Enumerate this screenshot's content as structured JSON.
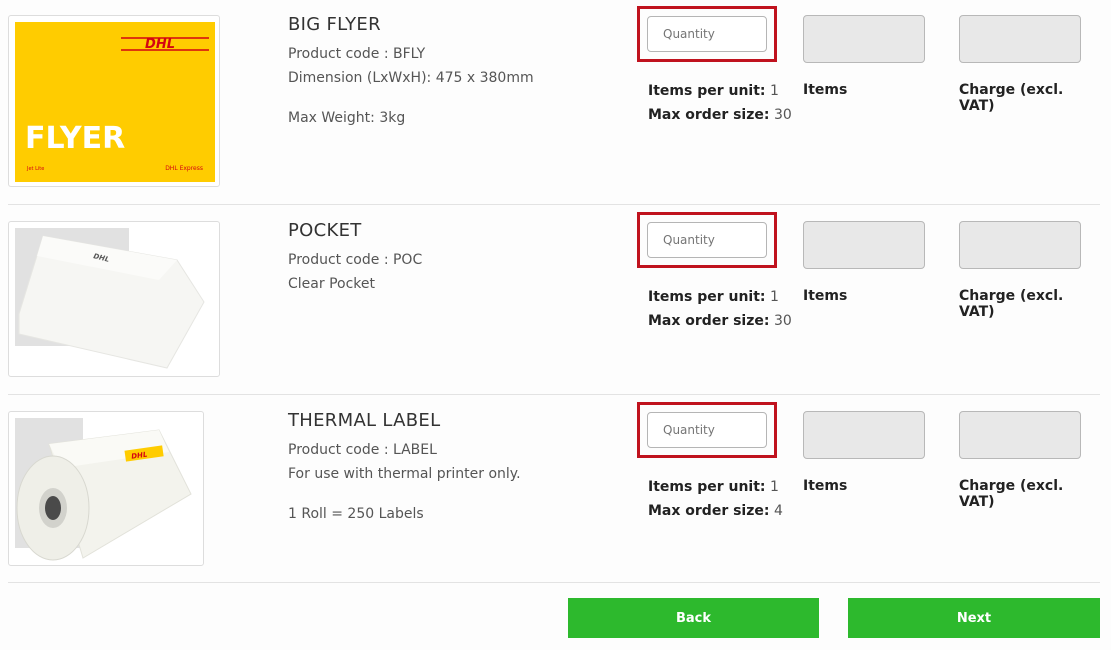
{
  "products": [
    {
      "title": "BIG FLYER",
      "code_line": "Product code : BFLY",
      "line2": "Dimension (LxWxH): 475 x 380mm",
      "line3": "Max Weight: 3kg",
      "qty_placeholder": "Quantity",
      "items_per_unit_label": "Items per unit:",
      "items_per_unit_value": "1",
      "max_order_label": "Max order size:",
      "max_order_value": "30",
      "items_label": "Items",
      "charge_label": "Charge (excl. VAT)",
      "image": {
        "brand": "DHL",
        "word": "FLYER",
        "small_left": "Jet Lite",
        "small_right": "DHL Express"
      }
    },
    {
      "title": "POCKET",
      "code_line": "Product code : POC",
      "line2": "Clear Pocket",
      "qty_placeholder": "Quantity",
      "items_per_unit_label": "Items per unit:",
      "items_per_unit_value": "1",
      "max_order_label": "Max order size:",
      "max_order_value": "30",
      "items_label": "Items",
      "charge_label": "Charge (excl. VAT)",
      "image": {
        "brand": "DHL"
      }
    },
    {
      "title": "THERMAL LABEL",
      "code_line": "Product code : LABEL",
      "line2": "For use with thermal printer only.",
      "line3": "1 Roll = 250 Labels",
      "qty_placeholder": "Quantity",
      "items_per_unit_label": "Items per unit:",
      "items_per_unit_value": "1",
      "max_order_label": "Max order size:",
      "max_order_value": "4",
      "items_label": "Items",
      "charge_label": "Charge (excl. VAT)",
      "image": {
        "brand": "DHL"
      }
    }
  ],
  "buttons": {
    "back": "Back",
    "next": "Next"
  },
  "colors": {
    "dhl_yellow": "#ffcc00",
    "dhl_red": "#d40511",
    "highlight_border": "#c0121e",
    "button_green": "#2db92d",
    "readonly_box": "#e8e8e8"
  }
}
